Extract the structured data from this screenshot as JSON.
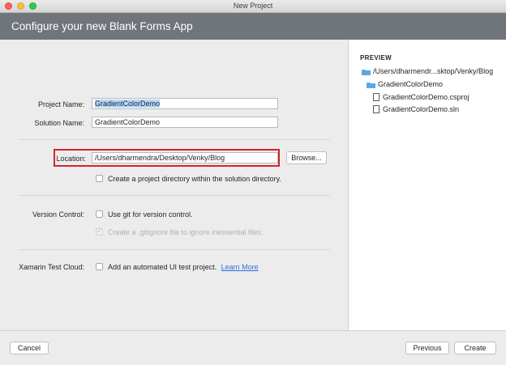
{
  "window": {
    "title": "New Project"
  },
  "header": {
    "title": "Configure your new Blank Forms App"
  },
  "form": {
    "project_name_label": "Project Name:",
    "project_name_value": "GradientColorDemo",
    "solution_name_label": "Solution Name:",
    "solution_name_value": "GradientColorDemo",
    "location_label": "Location:",
    "location_value": "/Users/dharmendra/Desktop/Venky/Blog",
    "browse_label": "Browse...",
    "create_dir_label": "Create a project directory within the solution directory.",
    "version_control_label": "Version Control:",
    "use_git_label": "Use git for version control.",
    "gitignore_label": "Create a .gitignore file to ignore inessential files.",
    "test_cloud_label": "Xamarin Test Cloud:",
    "ui_test_label": "Add an automated UI test project.",
    "learn_more_label": "Learn More"
  },
  "preview": {
    "title": "PREVIEW",
    "root_path": "/Users/dharmendr...sktop/Venky/Blog",
    "project_folder": "GradientColorDemo",
    "csproj_file": "GradientColorDemo.csproj",
    "sln_file": "GradientColorDemo.sln",
    "folder_color": "#5aa9e6"
  },
  "footer": {
    "cancel_label": "Cancel",
    "previous_label": "Previous",
    "create_label": "Create"
  },
  "colors": {
    "header_bg": "#6f757b",
    "highlight_border": "#d0262c",
    "link": "#2f6fd6"
  }
}
